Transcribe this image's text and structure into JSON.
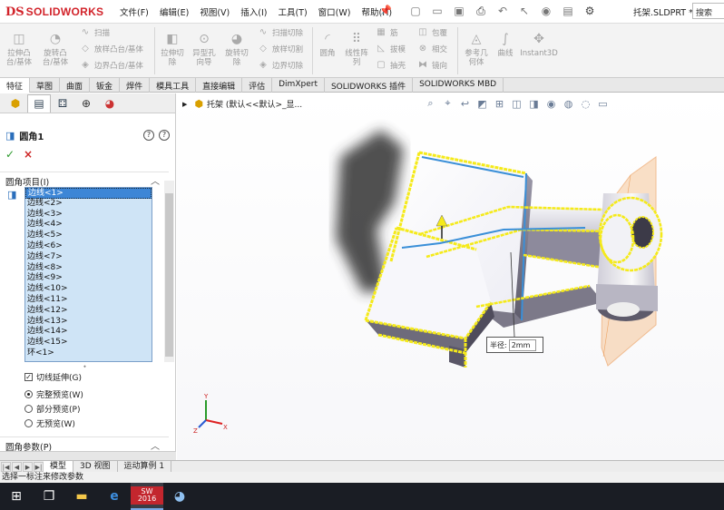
{
  "app": {
    "logo_mark": "DS",
    "logo_text": "SOLIDWORKS",
    "document_name": "托架.SLDPRT *",
    "search_placeholder": "搜索"
  },
  "menu": [
    "文件(F)",
    "编辑(E)",
    "视图(V)",
    "插入(I)",
    "工具(T)",
    "窗口(W)",
    "帮助(H)"
  ],
  "quick_access_icons": [
    "new-icon",
    "open-icon",
    "save-icon",
    "print-icon",
    "undo-icon",
    "select-icon",
    "rebuild-icon",
    "file-properties-icon",
    "options-icon"
  ],
  "ribbon": {
    "extrude_boss": "拉伸凸\n台/基体",
    "revolve_boss": "旋转凸\n台/基体",
    "sweep": "扫描",
    "loft_boss": "放样凸台/基体",
    "boundary_boss": "边界凸台/基体",
    "extrude_cut": "拉伸切\n除",
    "hole_wizard": "异型孔\n向导",
    "revolve_cut": "旋转切\n除",
    "swept_cut": "扫描切除",
    "loft_cut": "放样切割",
    "boundary_cut": "边界切除",
    "fillet": "圆角",
    "linear_pattern": "线性阵\n列",
    "rib": "筋",
    "draft": "拔模",
    "shell": "抽壳",
    "wrap": "包覆",
    "intersect": "相交",
    "mirror": "镜向",
    "ref_geometry": "参考几\n何体",
    "curves": "曲线",
    "instant3d": "Instant3D"
  },
  "tabs": [
    "特征",
    "草图",
    "曲面",
    "钣金",
    "焊件",
    "模具工具",
    "直接编辑",
    "评估",
    "DimXpert",
    "SOLIDWORKS 插件",
    "SOLIDWORKS MBD"
  ],
  "property_manager": {
    "title": "圆角1",
    "help": "?",
    "ok": "✓",
    "cancel": "×",
    "items_header": "圆角项目(I)",
    "edges": [
      "边线<1>",
      "边线<2>",
      "边线<3>",
      "边线<4>",
      "边线<5>",
      "边线<6>",
      "边线<7>",
      "边线<8>",
      "边线<9>",
      "边线<10>",
      "边线<11>",
      "边线<12>",
      "边线<13>",
      "边线<14>",
      "边线<15>",
      "环<1>"
    ],
    "tangent_propagation": "切线延伸(G)",
    "tangent_checked": true,
    "preview_full": "完整预览(W)",
    "preview_partial": "部分预览(P)",
    "preview_none": "无预览(W)",
    "preview_selected": "full",
    "params_header": "圆角参数(P)"
  },
  "viewport": {
    "tree_label": "托架 (默认<<默认>_显...",
    "radius_label": "半径:",
    "radius_value": "2mm",
    "triad_labels": [
      "X",
      "Y",
      "Z"
    ]
  },
  "bottom_tabs": [
    "模型",
    "3D 视图",
    "运动算例 1"
  ],
  "status_text": "选择一标注来修改参数",
  "taskbar": [
    "windows-start-icon",
    "task-view-icon",
    "file-explorer-icon",
    "edge-browser-icon",
    "solidworks-icon",
    "paint-icon"
  ],
  "taskbar_sw_label": "SW 2016",
  "colors": {
    "brand": "#d2232a",
    "selection_list": "#cfe4f6",
    "highlight_yellow": "#f5ea1a",
    "highlight_blue": "#3a8fd8",
    "taskbar": "#1a1d24"
  }
}
